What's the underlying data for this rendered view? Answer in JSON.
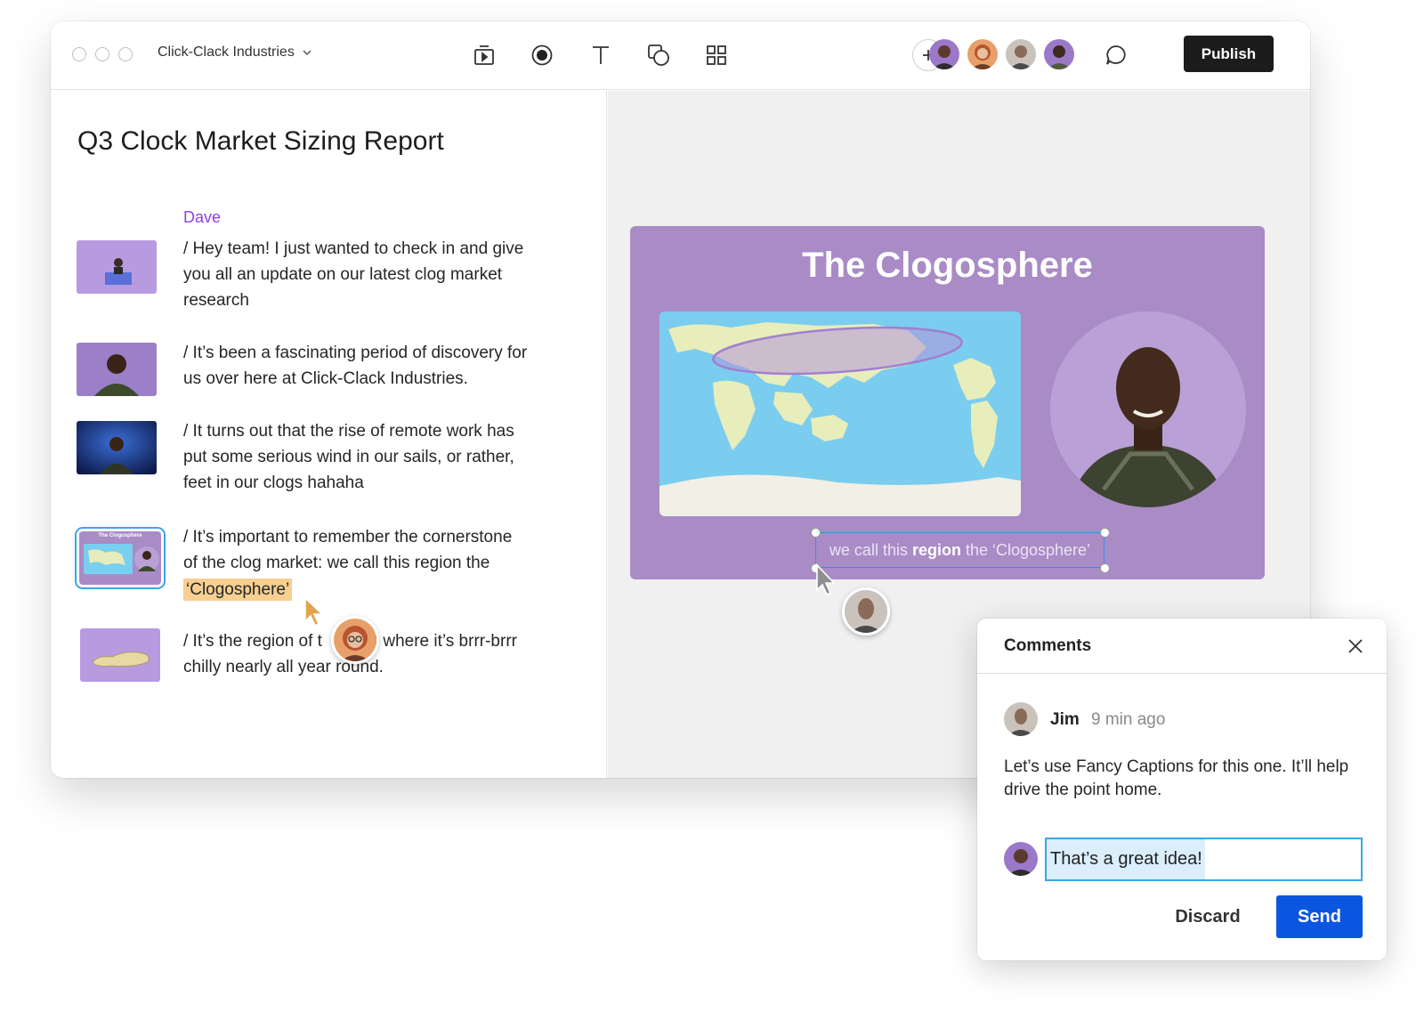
{
  "window": {
    "project_name": "Click-Clack Industries",
    "toolbar_icons": [
      "scene-icon",
      "record-icon",
      "text-icon",
      "shapes-icon",
      "grid-icon"
    ],
    "collaborators": [
      "avatar-1",
      "avatar-2",
      "avatar-3",
      "avatar-4"
    ],
    "publish_label": "Publish"
  },
  "document": {
    "title": "Q3 Clock Market Sizing Report",
    "speaker": "Dave",
    "paragraphs": [
      {
        "line1": "/ Hey team! I just wanted to check in and give",
        "line2": "you all an update on our latest clog market",
        "line3": "research"
      },
      {
        "line1": "/ It’s been a fascinating period of discovery for",
        "line2": "us over here at Click-Clack Industries."
      },
      {
        "line1": "/ It turns out that the rise of remote work has",
        "line2": "put some serious wind in our sails, or rather,",
        "line3": "feet in our clogs hahaha"
      },
      {
        "line1": "/ It’s important to remember the cornerstone",
        "line2": "of the clog market: we call this region the",
        "highlight": "‘Clogosphere’"
      },
      {
        "line1a": "/ It’s the region of t",
        "line1b": "rld where it’s brrr-brrr",
        "line2a": "chilly nearly all year ",
        "line2b": "round."
      }
    ],
    "thumb_mini_title": "The Clogosphere"
  },
  "slide": {
    "title": "The Clogosphere",
    "caption_pre": "we call this",
    "caption_bold": "region",
    "caption_post": "the ‘Clogosphere’"
  },
  "comments": {
    "title": "Comments",
    "author": "Jim",
    "time": "9 min ago",
    "body": "Let’s use Fancy Captions for this one. It’ll help drive the point home.",
    "reply_value": "That’s a great idea!",
    "discard_label": "Discard",
    "send_label": "Send"
  },
  "colors": {
    "accent_purple": "#8e3df5",
    "slide_bg": "#a98bc6",
    "highlight": "#f6cf91",
    "send_blue": "#0a56e0",
    "publish_bg": "#1c1c1c"
  }
}
